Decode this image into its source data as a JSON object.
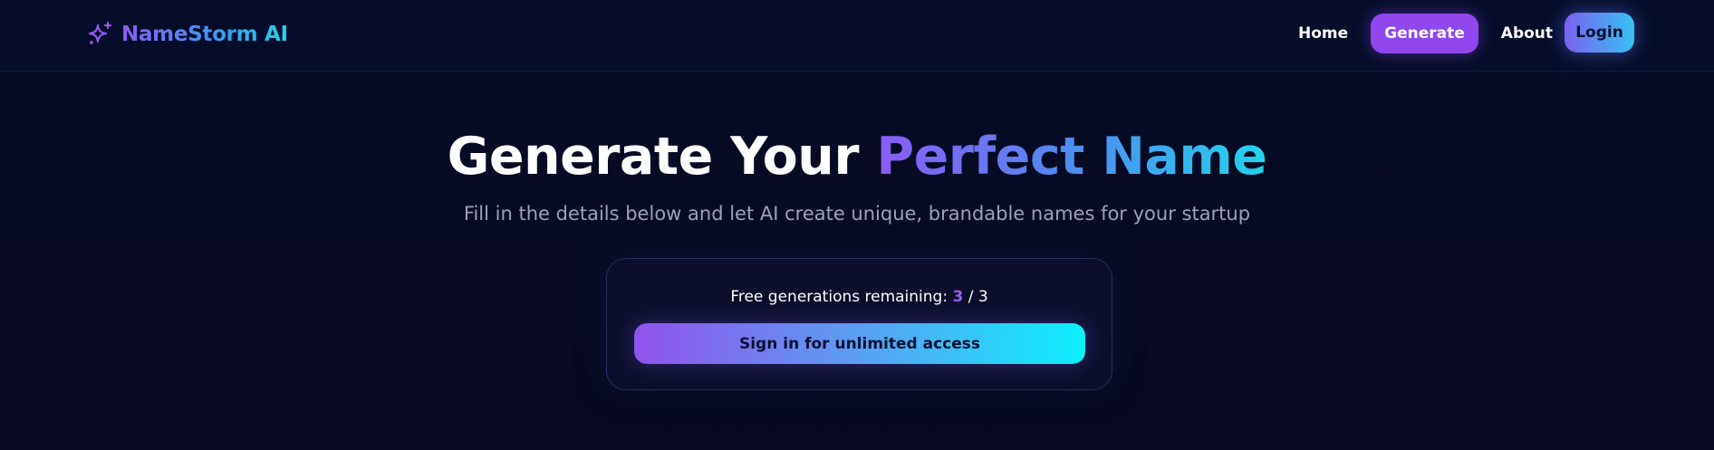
{
  "navbar": {
    "brand_name": "NameStorm AI",
    "brand_icon": "sparkles-icon",
    "links": {
      "home": "Home",
      "generate": "Generate",
      "about": "About"
    },
    "login_label": "Login",
    "active_link": "generate"
  },
  "hero": {
    "title_plain": "Generate Your ",
    "title_accent": "Perfect Name",
    "subtitle": "Fill in the details below and let AI create unique, brandable names for your startup"
  },
  "card": {
    "remaining_label": "Free generations remaining:",
    "remaining_count": "3",
    "remaining_total": "/ 3",
    "signin_label": "Sign in for unlimited access"
  },
  "colors": {
    "accent_purple": "#9146ee",
    "accent_cyan": "#22d3ee",
    "background": "#070b24"
  }
}
